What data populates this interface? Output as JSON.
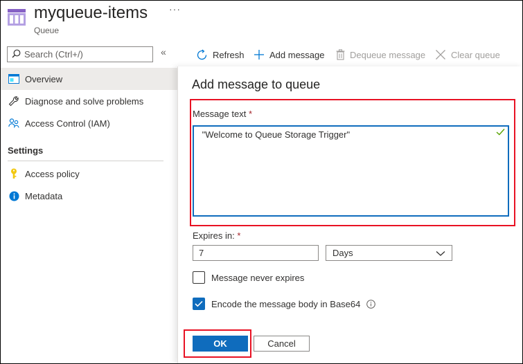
{
  "header": {
    "title": "myqueue-items",
    "subtitle": "Queue",
    "more": "···"
  },
  "sidebar": {
    "search_placeholder": "Search (Ctrl+/)",
    "collapse": "«",
    "items": [
      {
        "label": "Overview",
        "icon": "overview-icon"
      },
      {
        "label": "Diagnose and solve problems",
        "icon": "wrench-icon"
      },
      {
        "label": "Access Control (IAM)",
        "icon": "people-icon"
      }
    ],
    "section": "Settings",
    "settings_items": [
      {
        "label": "Access policy",
        "icon": "key-icon"
      },
      {
        "label": "Metadata",
        "icon": "info-icon"
      }
    ]
  },
  "toolbar": {
    "refresh": "Refresh",
    "add_message": "Add message",
    "dequeue": "Dequeue message",
    "clear": "Clear queue"
  },
  "panel": {
    "title": "Add message to queue",
    "message_label": "Message text",
    "required_mark": "*",
    "message_value": " \"Welcome to Queue Storage Trigger\"",
    "expires_label": "Expires in:",
    "expires_value": "7",
    "unit_selected": "Days",
    "never_expires_label": "Message never expires",
    "never_expires_checked": false,
    "base64_label": "Encode the message body in Base64",
    "base64_checked": true,
    "ok": "OK",
    "cancel": "Cancel"
  },
  "colors": {
    "accent": "#0f6cbd",
    "highlight": "#e81123",
    "required": "#a4262c",
    "valid": "#57a300"
  }
}
